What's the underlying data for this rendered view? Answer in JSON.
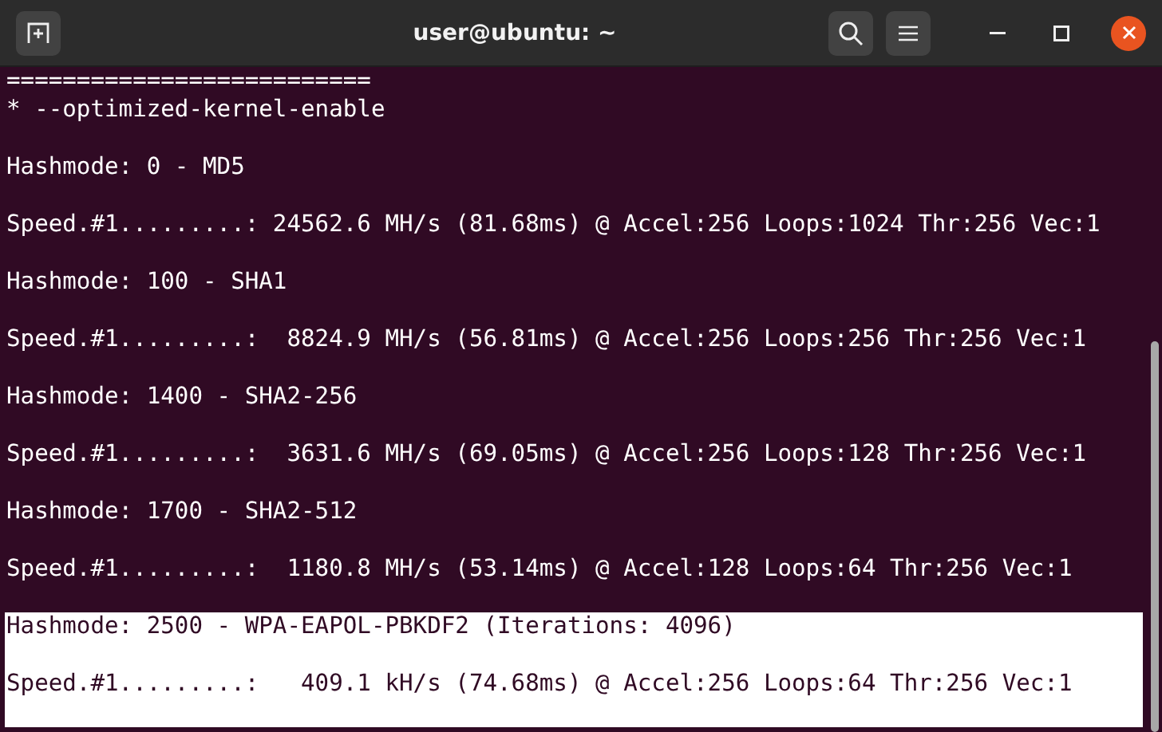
{
  "window": {
    "title": "user@ubuntu: ~"
  },
  "terminal": {
    "blocks": [
      {
        "lines": [
          "==========================",
          "* --optimized-kernel-enable"
        ],
        "selected": false
      },
      {
        "lines": [
          "Hashmode: 0 - MD5"
        ],
        "selected": false
      },
      {
        "lines": [
          "Speed.#1.........: 24562.6 MH/s (81.68ms) @ Accel:256 Loops:1024 Thr:256 Vec:1"
        ],
        "selected": false
      },
      {
        "lines": [
          "Hashmode: 100 - SHA1"
        ],
        "selected": false
      },
      {
        "lines": [
          "Speed.#1.........:  8824.9 MH/s (56.81ms) @ Accel:256 Loops:256 Thr:256 Vec:1"
        ],
        "selected": false
      },
      {
        "lines": [
          "Hashmode: 1400 - SHA2-256"
        ],
        "selected": false
      },
      {
        "lines": [
          "Speed.#1.........:  3631.6 MH/s (69.05ms) @ Accel:256 Loops:128 Thr:256 Vec:1"
        ],
        "selected": false
      },
      {
        "lines": [
          "Hashmode: 1700 - SHA2-512"
        ],
        "selected": false
      },
      {
        "lines": [
          "Speed.#1.........:  1180.8 MH/s (53.14ms) @ Accel:128 Loops:64 Thr:256 Vec:1"
        ],
        "selected": false
      },
      {
        "lines": [
          "Hashmode: 2500 - WPA-EAPOL-PBKDF2 (Iterations: 4096)"
        ],
        "selected": true
      },
      {
        "lines": [
          "Speed.#1.........:   409.1 kH/s (74.68ms) @ Accel:256 Loops:64 Thr:256 Vec:1"
        ],
        "selected": true
      }
    ]
  }
}
